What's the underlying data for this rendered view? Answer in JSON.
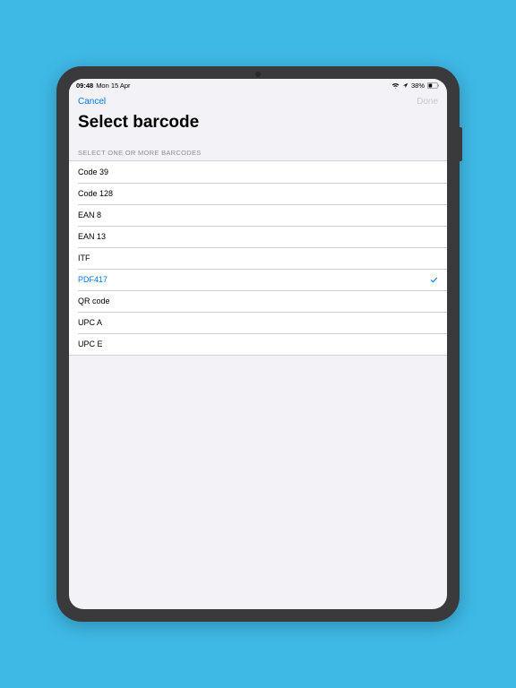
{
  "status_bar": {
    "time": "09:48",
    "date": "Mon 15 Apr",
    "battery_pct": "38%"
  },
  "nav": {
    "cancel": "Cancel",
    "done": "Done"
  },
  "page": {
    "title": "Select barcode",
    "section_header": "SELECT ONE OR MORE BARCODES"
  },
  "barcodes": [
    {
      "label": "Code 39",
      "selected": false
    },
    {
      "label": "Code 128",
      "selected": false
    },
    {
      "label": "EAN 8",
      "selected": false
    },
    {
      "label": "EAN 13",
      "selected": false
    },
    {
      "label": "ITF",
      "selected": false
    },
    {
      "label": "PDF417",
      "selected": true
    },
    {
      "label": "QR code",
      "selected": false
    },
    {
      "label": "UPC A",
      "selected": false
    },
    {
      "label": "UPC E",
      "selected": false
    }
  ]
}
